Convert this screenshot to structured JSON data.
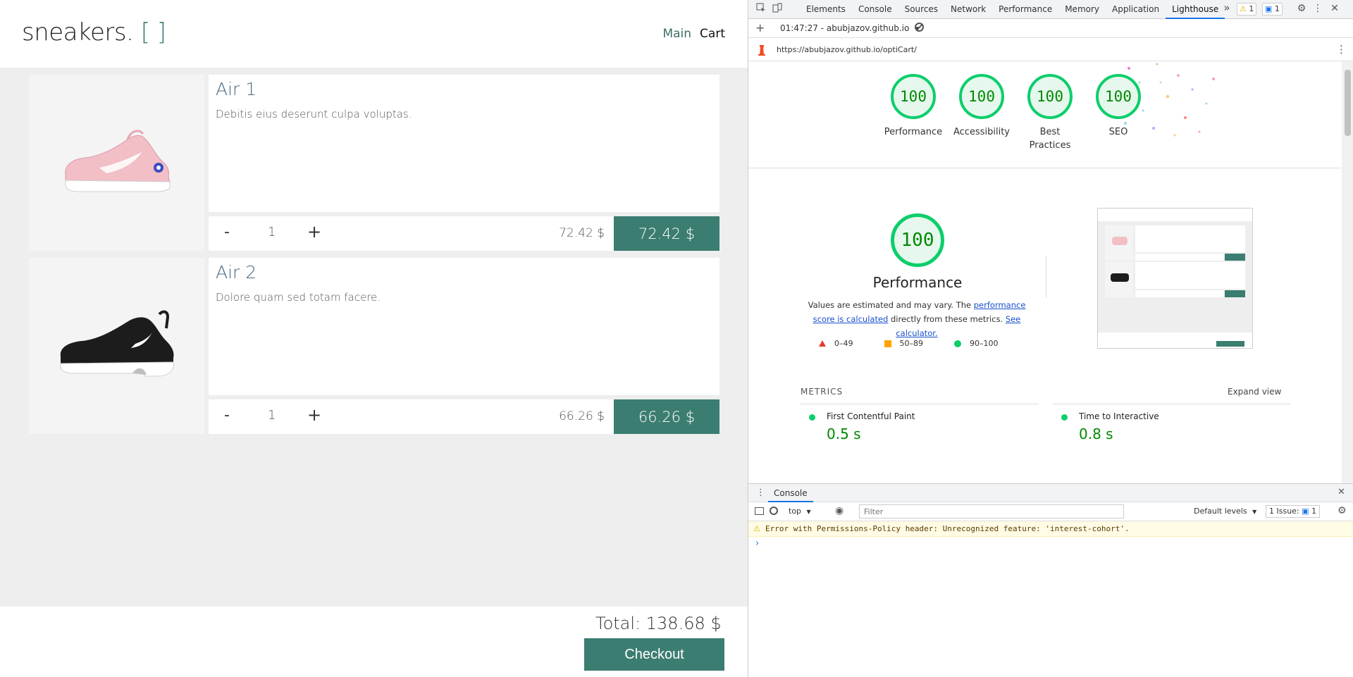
{
  "shop": {
    "logo": "sneakers.",
    "logo_brackets": "[ ]",
    "nav": {
      "main": "Main",
      "cart": "Cart"
    },
    "items": [
      {
        "name": "Air 1",
        "description": "Debitis eius deserunt culpa voluptas.",
        "minus": "-",
        "quantity": "1",
        "plus": "+",
        "unit_price": "72.42 $",
        "line_total": "72.42 $"
      },
      {
        "name": "Air 2",
        "description": "Dolore quam sed totam facere.",
        "minus": "-",
        "quantity": "1",
        "plus": "+",
        "unit_price": "66.26 $",
        "line_total": "66.26 $"
      }
    ],
    "total": "Total: 138.68 $",
    "checkout": "Checkout",
    "accent_color": "#3b7d71"
  },
  "devtools": {
    "tabs": [
      "Elements",
      "Console",
      "Sources",
      "Network",
      "Performance",
      "Memory",
      "Application",
      "Lighthouse"
    ],
    "active_tab": "Lighthouse",
    "more_tabs": "»",
    "warnings_badge": "1",
    "messages_badge": "1",
    "lighthouse_bar": {
      "add": "+",
      "report_select": "01:47:27 - abubjazov.github.io",
      "dropdown": "▼"
    },
    "url": "https://abubjazov.github.io/optiCart/",
    "gauges": [
      {
        "score": "100",
        "label": "Performance"
      },
      {
        "score": "100",
        "label": "Accessibility"
      },
      {
        "score": "100",
        "label": "Best Practices"
      },
      {
        "score": "100",
        "label": "SEO"
      }
    ],
    "performance": {
      "score": "100",
      "title": "Performance",
      "note_prefix": "Values are estimated and may vary. The ",
      "note_link1": "performance score is calculated",
      "note_middle": " directly from these metrics. ",
      "note_link2": "See calculator.",
      "legend": [
        {
          "shape": "triangle",
          "range": "0–49",
          "color": "#e53935"
        },
        {
          "shape": "square",
          "range": "50–89",
          "color": "#ffa400"
        },
        {
          "shape": "circle",
          "range": "90–100",
          "color": "#0cce6b"
        }
      ]
    },
    "metrics_title": "METRICS",
    "expand_view": "Expand view",
    "metrics": [
      {
        "name": "First Contentful Paint",
        "value": "0.5 s"
      },
      {
        "name": "Time to Interactive",
        "value": "0.8 s"
      }
    ],
    "console": {
      "tab": "Console",
      "context": "top",
      "filter_placeholder": "Filter",
      "levels": "Default levels",
      "issues_label": "1 Issue:",
      "issues_count": "1",
      "warning": "Error with Permissions-Policy header: Unrecognized feature: 'interest-cohort'.",
      "prompt": "›"
    },
    "pass_color": "#0cce6b"
  }
}
